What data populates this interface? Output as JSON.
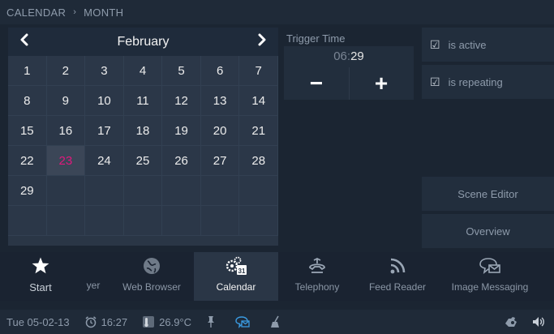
{
  "breadcrumb": {
    "section": "CALENDAR",
    "page": "MONTH",
    "separator": "›"
  },
  "calendar": {
    "month": "February",
    "prev_icon": "chevron-left-icon",
    "next_icon": "chevron-right-icon",
    "days": [
      "1",
      "2",
      "3",
      "4",
      "5",
      "6",
      "7",
      "8",
      "9",
      "10",
      "11",
      "12",
      "13",
      "14",
      "15",
      "16",
      "17",
      "18",
      "19",
      "20",
      "21",
      "22",
      "23",
      "24",
      "25",
      "26",
      "27",
      "28",
      "29"
    ],
    "today": "23",
    "today_color": "#e0197d"
  },
  "trigger": {
    "label": "Trigger Time",
    "hours": "06",
    "separator": ":",
    "minutes": "29",
    "minus_label": "−",
    "plus_label": "+"
  },
  "options": {
    "active_label": "is active",
    "repeating_label": "is repeating",
    "check_glyph": "☑"
  },
  "side_buttons": {
    "scene_editor": "Scene Editor",
    "overview": "Overview"
  },
  "dock": {
    "items": [
      {
        "label": "Start",
        "icon": "star-icon"
      },
      {
        "label": "yer",
        "icon": ""
      },
      {
        "label": "Web Browser",
        "icon": "globe-icon"
      },
      {
        "label": "Calendar",
        "icon": "calendar-gear-icon"
      },
      {
        "label": "Telephony",
        "icon": "phone-icon"
      },
      {
        "label": "Feed Reader",
        "icon": "rss-icon"
      },
      {
        "label": "Image Messaging",
        "icon": "message-icon"
      }
    ],
    "calendar_badge": "31"
  },
  "status": {
    "date": "Tue 05-02-13",
    "time": "16:27",
    "temperature": "26.9°C"
  },
  "colors": {
    "accent_today": "#e0197d",
    "panel": "#2a3646",
    "background": "#1b2532"
  }
}
